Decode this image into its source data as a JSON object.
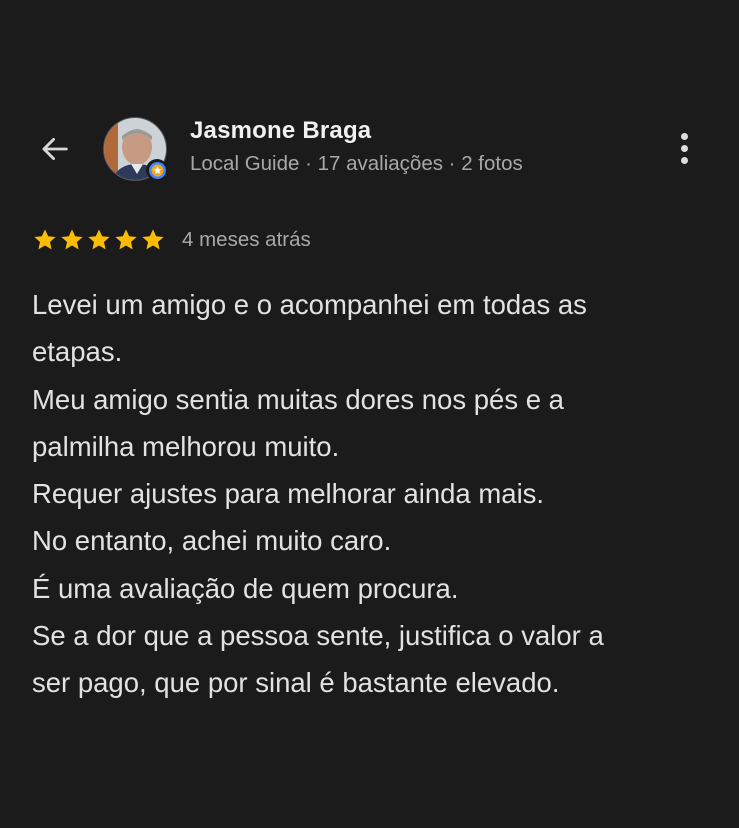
{
  "header": {
    "back_icon": "arrow-left-icon",
    "more_icon": "more-vertical-icon"
  },
  "reviewer": {
    "name": "Jasmone Braga",
    "meta": "Local Guide · 17 avaliações · 2 fotos",
    "badge_icon": "local-guide-star-icon"
  },
  "review": {
    "stars": 5,
    "star_color": "#fbbc04",
    "date": "4 meses atrás",
    "lines": [
      "Levei um amigo e o acompanhei em todas as",
      "etapas.",
      "Meu amigo sentia muitas dores nos pés e a",
      "palmilha melhorou muito.",
      "Requer ajustes para melhorar ainda mais.",
      "No entanto, achei muito caro.",
      "É uma avaliação de quem procura.",
      "Se a dor que a pessoa sente, justifica o valor a",
      "ser pago, que por sinal é bastante elevado."
    ]
  },
  "colors": {
    "background": "#1b1b1b",
    "text": "#e2e2e2",
    "secondary_text": "#a8a8a8",
    "guide_badge": "#4285f4"
  }
}
